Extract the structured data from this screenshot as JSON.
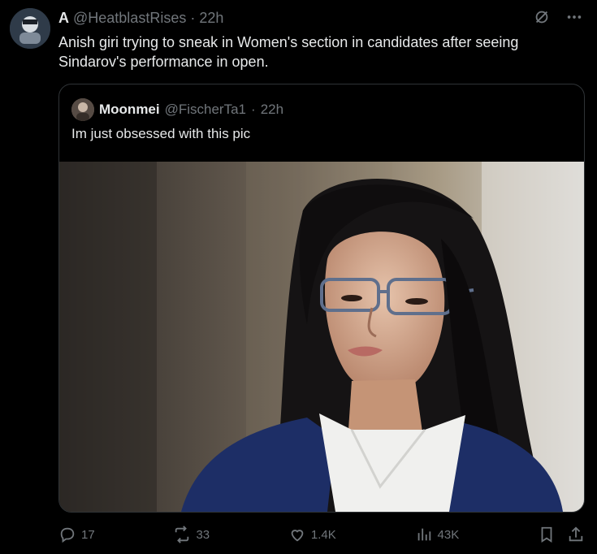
{
  "post": {
    "author_name": "A",
    "handle": "@HeatblastRises",
    "separator": "·",
    "time": "22h",
    "text": "Anish giri trying to sneak in Women's section in candidates after seeing Sindarov's performance in open."
  },
  "quote": {
    "author_name": "Moonmei",
    "handle": "@FischerTa1",
    "separator": "·",
    "time": "22h",
    "text": "Im just obsessed with this pic"
  },
  "actions": {
    "replies": "17",
    "reposts": "33",
    "likes": "1.4K",
    "views": "43K"
  },
  "icons": [
    "grok-icon",
    "more-icon",
    "reply-icon",
    "repost-icon",
    "like-icon",
    "views-icon",
    "bookmark-icon",
    "share-icon"
  ]
}
